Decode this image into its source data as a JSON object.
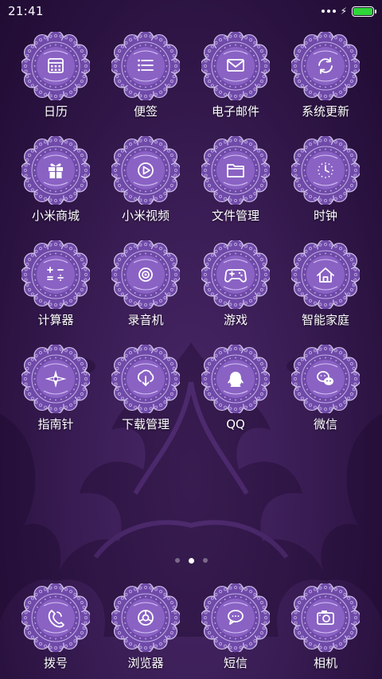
{
  "status_bar": {
    "time": "21:41",
    "battery_level": 1.0,
    "battery_color": "#2fd63a"
  },
  "home": {
    "rows": [
      [
        {
          "label": "日历",
          "icon": "calendar-icon"
        },
        {
          "label": "便签",
          "icon": "notes-icon"
        },
        {
          "label": "电子邮件",
          "icon": "mail-icon"
        },
        {
          "label": "系统更新",
          "icon": "update-icon"
        }
      ],
      [
        {
          "label": "小米商城",
          "icon": "gift-icon"
        },
        {
          "label": "小米视频",
          "icon": "play-icon"
        },
        {
          "label": "文件管理",
          "icon": "folder-icon"
        },
        {
          "label": "时钟",
          "icon": "clock-icon"
        }
      ],
      [
        {
          "label": "计算器",
          "icon": "calculator-icon"
        },
        {
          "label": "录音机",
          "icon": "record-icon"
        },
        {
          "label": "游戏",
          "icon": "gamepad-icon"
        },
        {
          "label": "智能家庭",
          "icon": "home-icon"
        }
      ],
      [
        {
          "label": "指南针",
          "icon": "compass-icon"
        },
        {
          "label": "下载管理",
          "icon": "download-icon"
        },
        {
          "label": "QQ",
          "icon": "qq-icon"
        },
        {
          "label": "微信",
          "icon": "wechat-icon"
        }
      ]
    ]
  },
  "pager": {
    "pages": 3,
    "current": 2
  },
  "dock": [
    {
      "label": "拨号",
      "icon": "phone-icon"
    },
    {
      "label": "浏览器",
      "icon": "browser-icon"
    },
    {
      "label": "短信",
      "icon": "message-icon"
    },
    {
      "label": "相机",
      "icon": "camera-icon"
    }
  ],
  "theme": {
    "badge_color": "#6f4aa8",
    "badge_inner": "#8a62c4",
    "lace_color": "#e8dcff"
  }
}
